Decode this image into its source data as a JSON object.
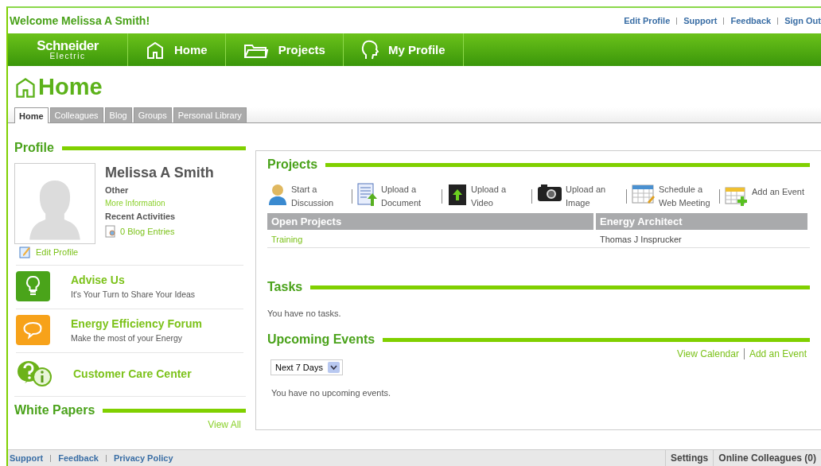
{
  "header": {
    "welcome": "Welcome Melissa A Smith!",
    "links": [
      "Edit Profile",
      "Support",
      "Feedback",
      "Sign Out"
    ]
  },
  "nav": {
    "logo": {
      "line1": "Schneider",
      "line2": "Electric"
    },
    "items": [
      {
        "kind": "home",
        "label": "Home"
      },
      {
        "kind": "projects",
        "label": "Projects"
      },
      {
        "kind": "profile",
        "label": "My Profile"
      }
    ]
  },
  "page_title": "Home",
  "tabs": [
    {
      "label": "Home",
      "selected": true
    },
    {
      "label": "Colleagues",
      "selected": false
    },
    {
      "label": "Blog",
      "selected": false
    },
    {
      "label": "Groups",
      "selected": false
    },
    {
      "label": "Personal Library",
      "selected": false
    }
  ],
  "profile": {
    "heading": "Profile",
    "name": "Melissa A Smith",
    "role": "Other",
    "more_link": "More Information",
    "recent_label": "Recent Activities",
    "blog_entries": "0 Blog Entries",
    "edit_link": "Edit Profile"
  },
  "promos": [
    {
      "kind": "idea",
      "title": "Advise Us",
      "subtitle": "It's Your Turn to Share Your Ideas"
    },
    {
      "kind": "forum",
      "title": "Energy Efficiency Forum",
      "subtitle": "Make the most of your Energy"
    },
    {
      "kind": "care",
      "title": "Customer Care Center"
    }
  ],
  "white_papers": {
    "heading": "White Papers",
    "view_all": "View All"
  },
  "projects": {
    "heading": "Projects",
    "actions": [
      {
        "kind": "discussion",
        "label": "Start a Discussion"
      },
      {
        "kind": "document",
        "label": "Upload a Document"
      },
      {
        "kind": "video",
        "label": "Upload a Video"
      },
      {
        "kind": "image",
        "label": "Upload an Image"
      },
      {
        "kind": "meeting",
        "label": "Schedule a Web Meeting"
      },
      {
        "kind": "event",
        "label": "Add an Event"
      }
    ],
    "columns": [
      "Open Projects",
      "Energy Architect"
    ],
    "rows": [
      [
        "Training",
        "Thomas J Insprucker"
      ]
    ]
  },
  "tasks": {
    "heading": "Tasks",
    "empty": "You have no tasks."
  },
  "events": {
    "heading": "Upcoming Events",
    "links": [
      "View Calendar",
      "Add an Event"
    ],
    "range": "Next 7 Days",
    "empty": "You have no upcoming events."
  },
  "footer": {
    "links": [
      "Support",
      "Feedback",
      "Privacy Policy"
    ],
    "buttons": [
      "Settings",
      "Online Colleagues (0)"
    ]
  }
}
